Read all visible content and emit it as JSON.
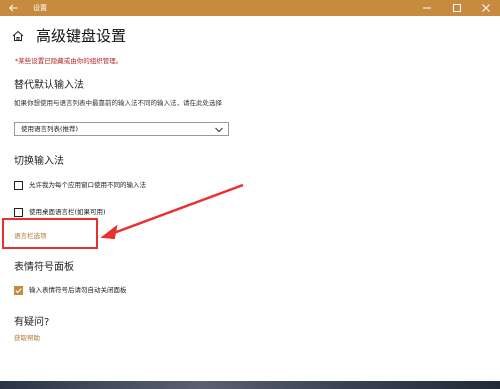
{
  "window": {
    "title": "设置",
    "accent_color": "#c78b3f"
  },
  "header": {
    "page_title": "高级键盘设置",
    "notice": "*某些设置已隐藏或由你的组织管理。"
  },
  "default_input": {
    "section_title": "替代默认输入法",
    "description": "如果你想使用与语言列表中最靠前的输入法不同的输入法，请在此处选择",
    "selected_option": "使用语言列表(推荐)"
  },
  "switch_input": {
    "section_title": "切换输入法",
    "options": [
      {
        "label": "允许我为每个应用窗口使用不同的输入法",
        "checked": false
      },
      {
        "label": "使用桌面语言栏(如果可用)",
        "checked": false
      }
    ],
    "language_bar_link": "语言栏选项"
  },
  "emoji_panel": {
    "section_title": "表情符号面板",
    "option_label": "输入表情符号后请勿自动关闭面板",
    "option_checked": true
  },
  "help": {
    "section_title": "有疑问?",
    "link": "获取帮助"
  },
  "annotation": {
    "color": "#e8312a"
  }
}
